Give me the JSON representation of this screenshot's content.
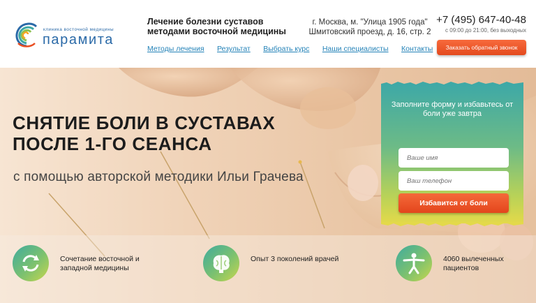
{
  "header": {
    "logo": {
      "small_text": "клиника восточной медицины",
      "name": "парамита"
    },
    "tagline": "Лечение болезни суставов методами восточной медицины",
    "address": {
      "line1": "г. Москва, м. \"Улица 1905 года\"",
      "line2": "Шмитовский проезд, д. 16, стр. 2"
    },
    "phone": "+7 (495) 647-40-48",
    "hours": "с 09:00 до 21:00, без выходных",
    "callback_label": "Заказать обратный звонок",
    "nav": [
      {
        "label": "Методы лечения"
      },
      {
        "label": "Результат"
      },
      {
        "label": "Выбрать курс"
      },
      {
        "label": "Наши специалисты"
      },
      {
        "label": "Контакты"
      }
    ]
  },
  "hero": {
    "title_line1": "СНЯТИЕ БОЛИ В СУСТАВАХ",
    "title_line2": "ПОСЛЕ 1-ГО СЕАНСА",
    "subtitle": "с помощью авторской методики Ильи Грачева"
  },
  "form": {
    "title": "Заполните форму и избавьтесь от боли уже завтра",
    "name_placeholder": "Ваше имя",
    "phone_placeholder": "Ваш телефон",
    "submit_label": "Избавится от боли"
  },
  "features": [
    {
      "icon": "refresh-icon",
      "text": "Сочетание восточной и западной медицины"
    },
    {
      "icon": "brain-icon",
      "text": "Опыт 3 поколений врачей"
    },
    {
      "icon": "person-stretch-icon",
      "text": "4060 вылеченных пациентов"
    }
  ],
  "colors": {
    "accent_blue": "#2583b8",
    "cta_orange": "#e94f22",
    "gradient_teal": "#3fa9a6",
    "gradient_yellow": "#e3d94a"
  }
}
